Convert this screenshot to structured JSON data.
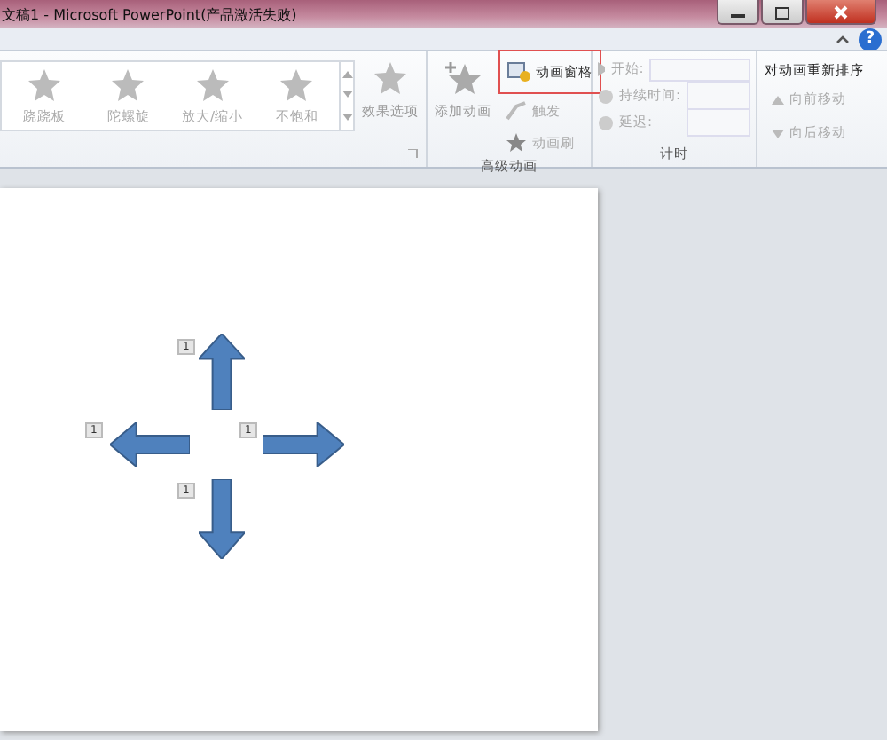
{
  "window": {
    "title": "文稿1 - Microsoft PowerPoint(产品激活失败)",
    "help": "?"
  },
  "animation_gallery": {
    "items": [
      {
        "label": "跷跷板"
      },
      {
        "label": "陀螺旋"
      },
      {
        "label": "放大/缩小"
      },
      {
        "label": "不饱和"
      }
    ]
  },
  "effect_options": {
    "label": "效果选项"
  },
  "advanced_animation": {
    "label": "高级动画",
    "add_animation": "添加动画",
    "animation_pane": {
      "label": "动画窗格",
      "highlighted": true
    },
    "trigger": "触发",
    "painter": "动画刷"
  },
  "timing": {
    "label": "计时",
    "start": "开始:",
    "duration": "持续时间:",
    "delay": "延迟:"
  },
  "reorder": {
    "title": "对动画重新排序",
    "forward": "向前移动",
    "backward": "向后移动"
  },
  "slide": {
    "shapes": [
      {
        "kind": "up",
        "tag": "1"
      },
      {
        "kind": "left",
        "tag": "1"
      },
      {
        "kind": "right",
        "tag": "1"
      },
      {
        "kind": "down",
        "tag": "1"
      }
    ]
  }
}
